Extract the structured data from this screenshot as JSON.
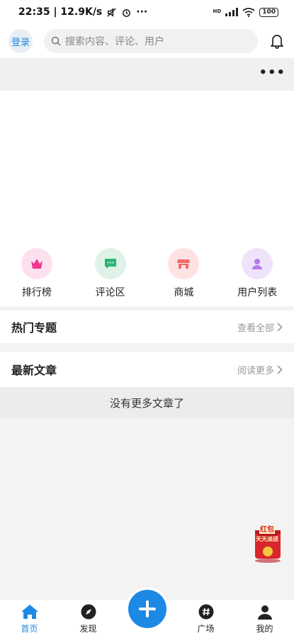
{
  "status_bar": {
    "time_speed": "22:35 | 12.9K/s",
    "overflow": "···",
    "network": "HD",
    "battery": "100"
  },
  "header": {
    "login_label": "登录",
    "search_placeholder": "搜索内容、评论、用户"
  },
  "strip": {
    "more_label": "•••"
  },
  "quick_nav": [
    {
      "label": "排行榜",
      "icon": "crown-icon",
      "color": "#f0368f"
    },
    {
      "label": "评论区",
      "icon": "chat-bubble-icon",
      "color": "#2bb673"
    },
    {
      "label": "商城",
      "icon": "store-icon",
      "color": "#f06a6a"
    },
    {
      "label": "用户列表",
      "icon": "user-icon",
      "color": "#b57ce8"
    }
  ],
  "hot_topics": {
    "title": "热门专题",
    "link": "查看全部"
  },
  "latest_articles": {
    "title": "最新文章",
    "link": "阅读更多"
  },
  "empty_message": "没有更多文章了",
  "red_packet": {
    "line1": "红包",
    "line2": "天天派送"
  },
  "tabs": [
    {
      "label": "首页",
      "icon": "home-icon",
      "active": true
    },
    {
      "label": "发现",
      "icon": "compass-icon",
      "active": false
    },
    {
      "label": "",
      "icon": "plus-icon",
      "active": false
    },
    {
      "label": "广场",
      "icon": "hashtag-icon",
      "active": false
    },
    {
      "label": "我的",
      "icon": "profile-icon",
      "active": false
    }
  ],
  "accent_color": "#1e88e5"
}
